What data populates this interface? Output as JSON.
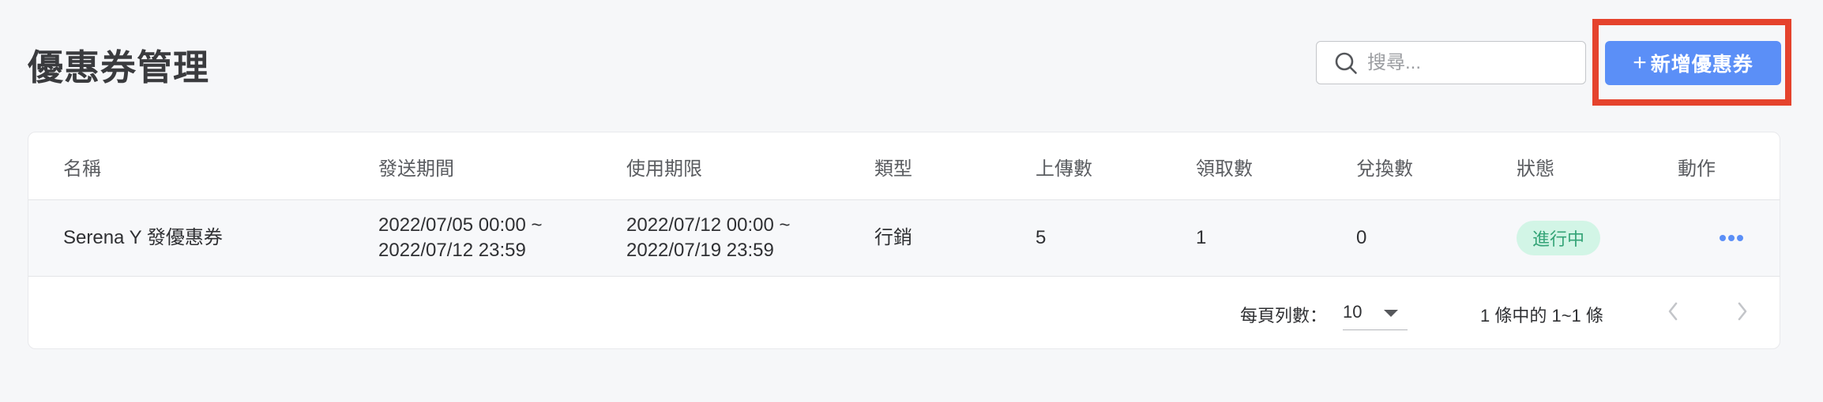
{
  "page": {
    "title": "優惠券管理"
  },
  "search": {
    "placeholder": "搜尋..."
  },
  "add_button": {
    "plus": "+",
    "label": "新增優惠券"
  },
  "table": {
    "columns": [
      "名稱",
      "發送期間",
      "使用期限",
      "類型",
      "上傳數",
      "領取數",
      "兌換數",
      "狀態",
      "動作"
    ],
    "rows": [
      {
        "name": "Serena Y 發優惠券",
        "send_period_start": "2022/07/05 00:00 ~",
        "send_period_end": "2022/07/12 23:59",
        "valid_start": "2022/07/12 00:00 ~",
        "valid_end": "2022/07/19 23:59",
        "type": "行銷",
        "uploaded": "5",
        "claimed": "1",
        "redeemed": "0",
        "status": "進行中"
      }
    ]
  },
  "pagination": {
    "rows_per_page_label": "每頁列數：",
    "rows_per_page_value": "10",
    "range_text": "1 條中的 1~1 條"
  },
  "colors": {
    "accent": "#5b8ff7",
    "highlight": "#e5432d",
    "status_bg": "#d2f5e6",
    "status_text": "#34a477"
  },
  "icons": {
    "search": "search-icon",
    "more": "more-horizontal-icon",
    "prev": "chevron-left-icon",
    "next": "chevron-right-icon",
    "dropdown": "caret-down-icon"
  }
}
